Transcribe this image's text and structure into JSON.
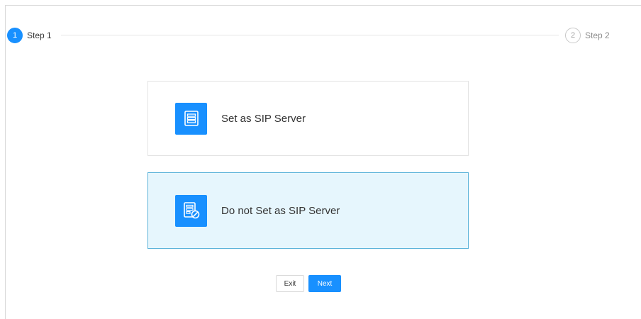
{
  "steps": [
    {
      "number": "1",
      "label": "Step 1",
      "status": "active"
    },
    {
      "number": "2",
      "label": "Step 2",
      "status": "inactive"
    }
  ],
  "options": [
    {
      "label": "Set as SIP Server",
      "icon": "server-icon",
      "selected": false
    },
    {
      "label": "Do not Set as SIP Server",
      "icon": "server-disabled-icon",
      "selected": true
    }
  ],
  "buttons": {
    "exit_label": "Exit",
    "next_label": "Next"
  },
  "colors": {
    "accent": "#1890ff",
    "selected_background": "#e6f6fd",
    "selected_border": "#5cb3da"
  }
}
